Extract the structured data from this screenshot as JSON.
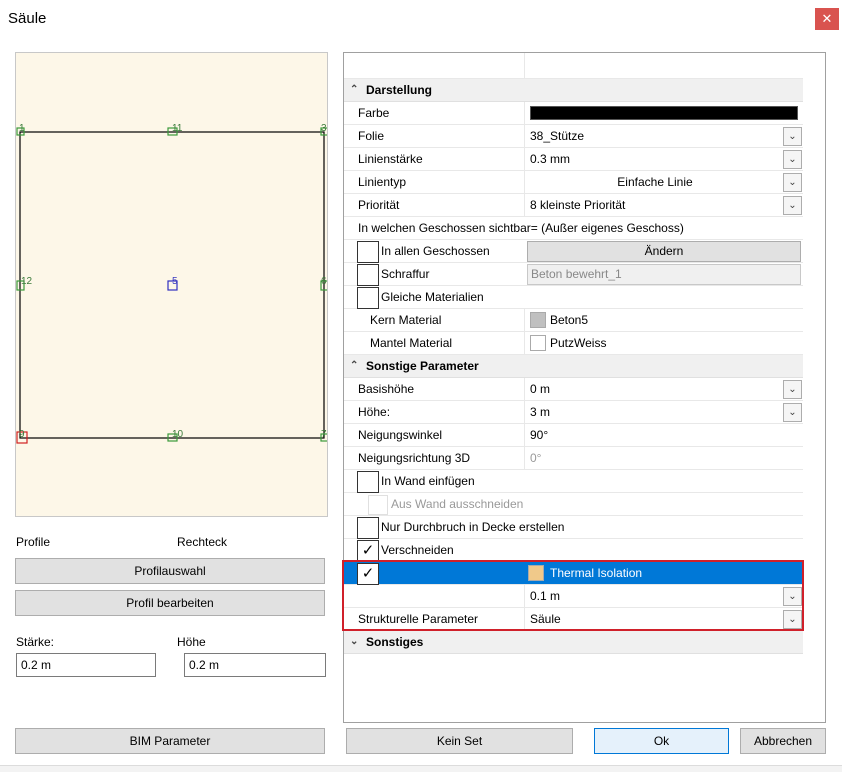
{
  "window": {
    "title": "Säule",
    "close_glyph": "✕"
  },
  "canvas": {
    "points": [
      {
        "label": "1"
      },
      {
        "label": "11"
      },
      {
        "label": "3"
      },
      {
        "label": "12"
      },
      {
        "label": "5"
      },
      {
        "label": "6"
      },
      {
        "label": "9"
      },
      {
        "label": "10"
      },
      {
        "label": "7"
      }
    ]
  },
  "left": {
    "profile_label": "Profile",
    "profile_value": "Rechteck",
    "profilauswahl": "Profilauswahl",
    "profil_bearbeiten": "Profil bearbeiten",
    "staerke_label": "Stärke:",
    "staerke_value": "0.2 m",
    "hoehe_label": "Höhe",
    "hoehe_value": "0.2 m",
    "bim_parameter": "BIM Parameter"
  },
  "grid": {
    "darstellung": "Darstellung",
    "farbe": "Farbe",
    "folie": "Folie",
    "folie_value": "38_Stütze",
    "linienstaerke": "Linienstärke",
    "linienstaerke_value": "0.3 mm",
    "linientyp": "Linientyp",
    "linientyp_value": "Einfache Linie",
    "prioritaet": "Priorität",
    "prioritaet_value": "8 kleinste Priorität",
    "sichtbar_text": "In welchen Geschossen sichtbar= (Außer eigenes Geschoss)",
    "in_allen": "In allen Geschossen",
    "aendern": "Ändern",
    "schraffur": "Schraffur",
    "schraffur_value": "Beton bewehrt_1",
    "gleiche_mat": "Gleiche Materialien",
    "kern_material": "Kern Material",
    "kern_value": "Beton5",
    "mantel_material": "Mantel Material",
    "mantel_value": "PutzWeiss",
    "sonstige_parameter": "Sonstige Parameter",
    "basishoehe": "Basishöhe",
    "basishoehe_value": "0 m",
    "hoehe": "Höhe:",
    "hoehe_value": "3 m",
    "neigungswinkel": "Neigungswinkel",
    "neigungswinkel_value": "90°",
    "neigungsrichtung": "Neigungsrichtung 3D",
    "neigungsrichtung_value": "0°",
    "in_wand": "In Wand einfügen",
    "aus_wand": "Aus Wand ausschneiden",
    "nur_durchbruch": "Nur Durchbruch in Decke erstellen",
    "verschneiden": "Verschneiden",
    "thermal": "Thermal Isolation",
    "thermal_thickness": "0.1 m",
    "strukturelle": "Strukturelle Parameter",
    "strukturelle_value": "Säule",
    "sonstiges": "Sonstiges",
    "check_glyph": "✓",
    "dropdown_glyph": "⌄",
    "collapse_glyph": "⌃",
    "expand_glyph": "⌄"
  },
  "buttons": {
    "kein_set": "Kein Set",
    "ok": "Ok",
    "abbrechen": "Abbrechen"
  },
  "colors": {
    "farbe_swatch": "#000000",
    "kern_swatch": "#c0c0c0",
    "mantel_swatch": "#ffffff",
    "thermal_swatch": "#f0c98a",
    "selection": "#0078d7",
    "highlight_border": "#d0202a"
  }
}
